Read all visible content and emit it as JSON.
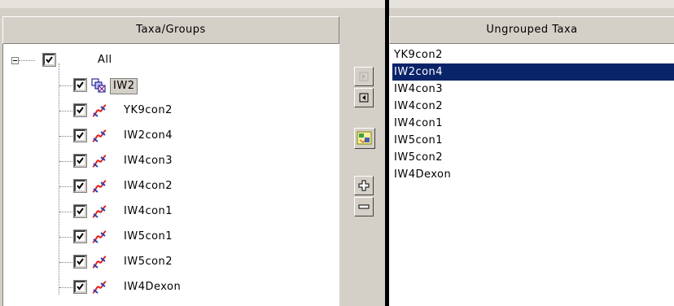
{
  "left_panel": {
    "header": "Taxa/Groups",
    "root": {
      "label": "All",
      "checked": true,
      "expander": "collapse"
    },
    "group": {
      "label": "IW2",
      "checked": true,
      "icon": "group-icon"
    },
    "taxa": [
      {
        "label": "YK9con2",
        "checked": true,
        "icon": "taxon-icon"
      },
      {
        "label": "IW2con4",
        "checked": true,
        "icon": "taxon-icon"
      },
      {
        "label": "IW4con3",
        "checked": true,
        "icon": "taxon-icon"
      },
      {
        "label": "IW4con2",
        "checked": true,
        "icon": "taxon-icon"
      },
      {
        "label": "IW4con1",
        "checked": true,
        "icon": "taxon-icon"
      },
      {
        "label": "IW5con1",
        "checked": true,
        "icon": "taxon-icon"
      },
      {
        "label": "IW5con2",
        "checked": true,
        "icon": "taxon-icon"
      },
      {
        "label": "IW4Dexon",
        "checked": true,
        "icon": "taxon-icon"
      }
    ]
  },
  "right_panel": {
    "header": "Ungrouped Taxa",
    "items": [
      "YK9con2",
      "IW2con4",
      "IW4con3",
      "IW4con2",
      "IW4con1",
      "IW5con1",
      "IW5con2",
      "IW4Dexon"
    ],
    "selected_index": 1
  },
  "toolbar": {
    "buttons": [
      {
        "icon": "move-right-arrow-icon",
        "enabled": false
      },
      {
        "icon": "move-left-arrow-icon",
        "enabled": true
      },
      {
        "icon": "new-group-icon",
        "enabled": true
      },
      {
        "icon": "plus-icon",
        "enabled": true
      },
      {
        "icon": "minus-icon",
        "enabled": true
      }
    ]
  },
  "colors": {
    "selection_bg": "#0a246a",
    "selection_fg": "#ffffff",
    "face": "#d4d0c8"
  }
}
